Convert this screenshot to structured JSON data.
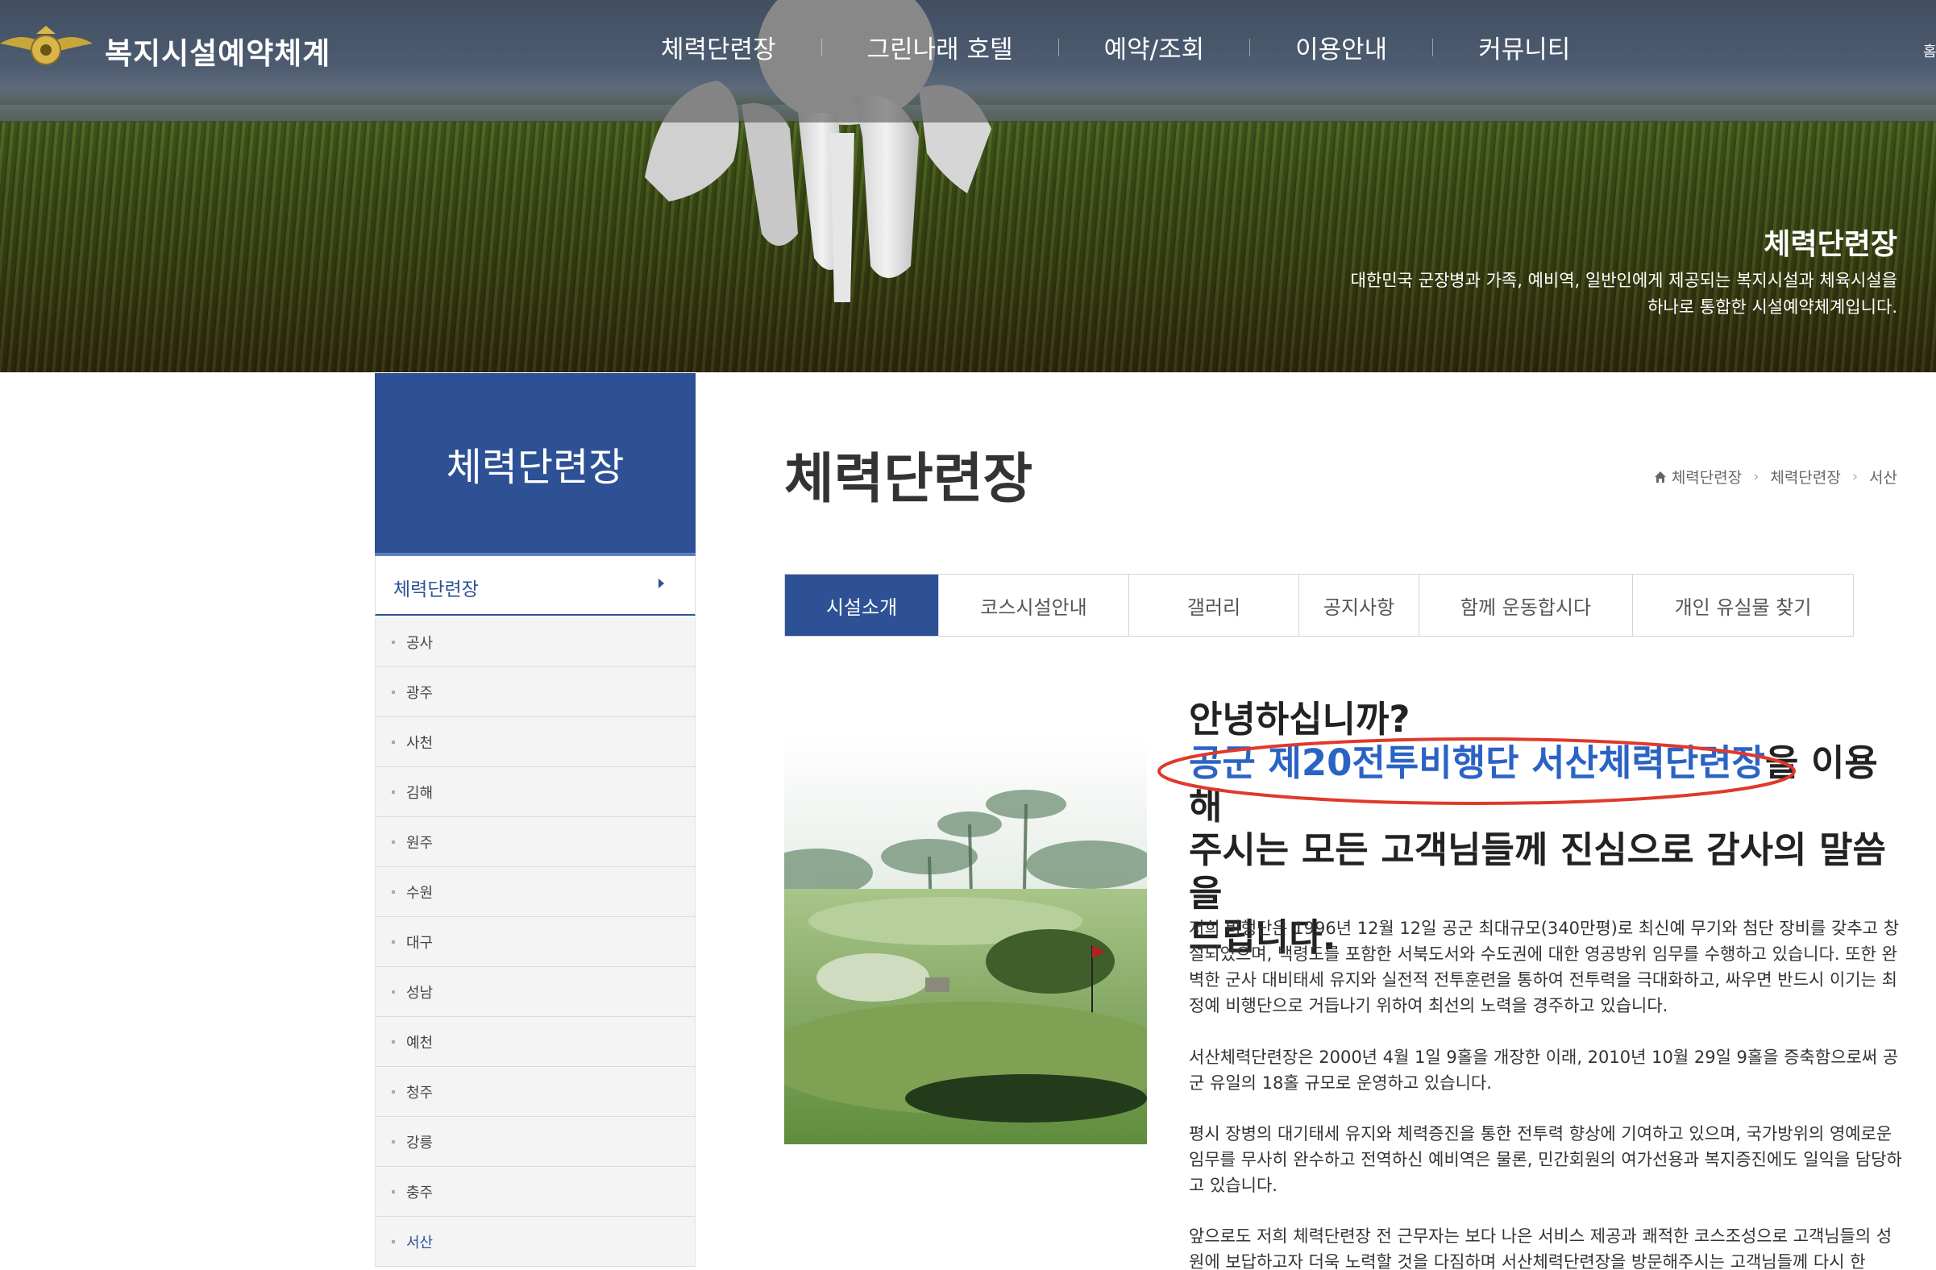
{
  "header": {
    "site_title": "복지시설예약체계",
    "nav": [
      "체력단련장",
      "그린나래 호텔",
      "예약/조회",
      "이용안내",
      "커뮤니티"
    ],
    "top_right_cut": "홈"
  },
  "hero": {
    "title": "체력단련장",
    "desc_line1": "대한민국 군장병과 가족, 예비역, 일반인에게 제공되는 복지시설과 체육시설을",
    "desc_line2": "하나로 통합한 시설예약체계입니다."
  },
  "sidebar": {
    "heading": "체력단련장",
    "active_item": "체력단련장",
    "items": [
      "공사",
      "광주",
      "사천",
      "김해",
      "원주",
      "수원",
      "대구",
      "성남",
      "예천",
      "청주",
      "강릉",
      "충주",
      "서산"
    ],
    "selected": "서산"
  },
  "main": {
    "page_title": "체력단련장",
    "breadcrumb": [
      "체력단련장",
      "체력단련장",
      "서산"
    ],
    "tabs": [
      "시설소개",
      "코스시설안내",
      "갤러리",
      "공지사항",
      "함께 운동합시다",
      "개인 유실물 찾기"
    ],
    "active_tab": "시설소개",
    "intro": {
      "greeting": "안녕하십니까?",
      "highlight": "공군 제20전투비행단 서산체력단련장",
      "rest_line1": "을 이용해",
      "rest_line2": "주시는 모든 고객님들께 진심으로 감사의 말씀을",
      "rest_line3": "드립니다."
    },
    "paragraphs": [
      "저희 비행단은 1996년 12월 12일 공군 최대규모(340만평)로 최신예 무기와 첨단 장비를 갖추고 창설되었으며, 백령도를 포함한 서북도서와 수도권에 대한 영공방위 임무를 수행하고 있습니다. 또한 완벽한 군사 대비태세 유지와 실전적 전투훈련을 통하여 전투력을 극대화하고, 싸우면 반드시 이기는 최정예 비행단으로 거듭나기 위하여 최선의 노력을 경주하고 있습니다.",
      "서산체력단련장은 2000년 4월 1일 9홀을 개장한 이래, 2010년 10월 29일 9홀을 증축함으로써 공군 유일의 18홀 규모로 운영하고 있습니다.",
      "평시 장병의 대기태세 유지와 체력증진을 통한 전투력 향상에 기여하고 있으며, 국가방위의 영예로운 임무를 무사히 완수하고 전역하신 예비역은 물론, 민간회원의 여가선용과 복지증진에도 일익을 담당하고 있습니다.",
      "앞으로도 저희 체력단련장 전 근무자는 보다 나은 서비스 제공과 쾌적한 코스조성으로 고객님들의 성원에 보답하고자 더욱 노력할 것을 다짐하며 서산체력단련장을 방문해주시는 고객님들께 다시 한"
    ]
  },
  "colors": {
    "primary": "#2d5194",
    "highlight_text": "#2a63c4",
    "annotation_circle": "#e0392b"
  }
}
